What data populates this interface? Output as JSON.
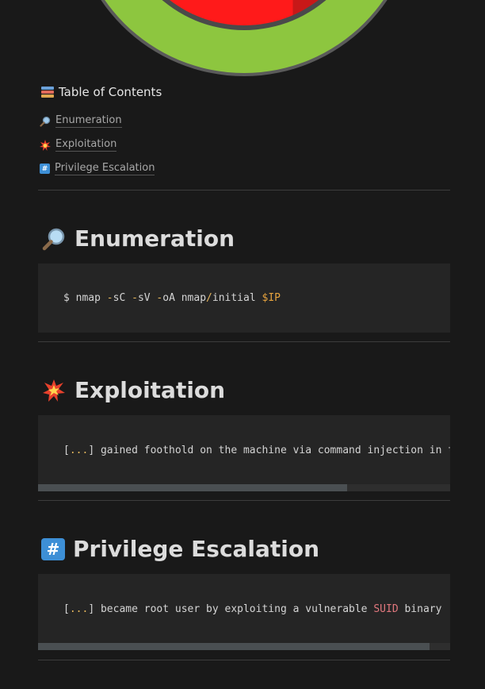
{
  "cover": {
    "colors": {
      "ring": "#8dc63f",
      "center": "#ff1a1a",
      "center_shade": "#c81818"
    }
  },
  "toc": {
    "title": "Table of Contents",
    "icon": "books-icon",
    "items": [
      {
        "label": "Enumeration",
        "icon": "magnifying-glass-icon"
      },
      {
        "label": "Exploitation",
        "icon": "collision-icon"
      },
      {
        "label": "Privilege Escalation",
        "icon": "hash-keycap-icon"
      }
    ]
  },
  "sections": {
    "enumeration": {
      "heading": "Enumeration",
      "icon": "magnifying-glass-icon",
      "code": {
        "prompt": "$ nmap ",
        "op1": "-",
        "t1": "sC ",
        "op2": "-",
        "t2": "sV ",
        "op3": "-",
        "t3": "oA nmap",
        "op4": "/",
        "t4": "initial ",
        "var": "$IP"
      }
    },
    "exploitation": {
      "heading": "Exploitation",
      "icon": "collision-icon",
      "code": {
        "open": "[",
        "dots": "...",
        "close": "]",
        "text": " gained foothold on the machine via command injection in the"
      },
      "scroll_fraction": 0.75
    },
    "privesc": {
      "heading": "Privilege Escalation",
      "icon": "hash-keycap-icon",
      "code": {
        "open": "[",
        "dots": "...",
        "close": "]",
        "text1": " became root user by exploiting a vulnerable ",
        "kw": "SUID",
        "text2": " binary ",
        "tail_open": "[",
        "tail_dots": ".."
      },
      "scroll_fraction": 0.95
    }
  }
}
